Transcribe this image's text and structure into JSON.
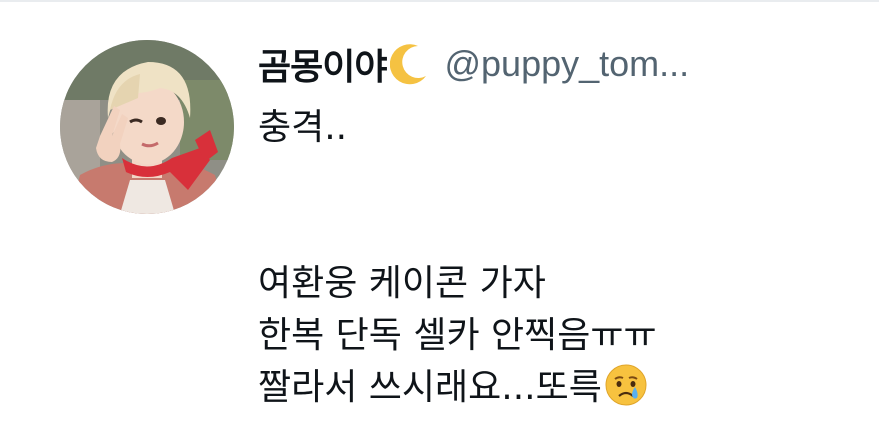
{
  "tweet": {
    "display_name": "곰몽이야",
    "name_emoji_icon": "crescent-moon-icon",
    "handle": "@puppy_tom...",
    "avatar_icon": "profile-photo",
    "text_lines": [
      "충격..",
      "",
      "",
      "여환웅 케이콘 가자",
      "한복 단독 셀카 안찍음ㅠㅠ",
      "짤라서 쓰시래요...또륵"
    ],
    "trailing_emoji_icon": "crying-face-icon"
  },
  "colors": {
    "text": "#0f1419",
    "handle": "#536471",
    "background": "#ffffff",
    "moon": "#f5c242",
    "cry_face": "#f7c23f",
    "tear": "#5ab0f0"
  }
}
